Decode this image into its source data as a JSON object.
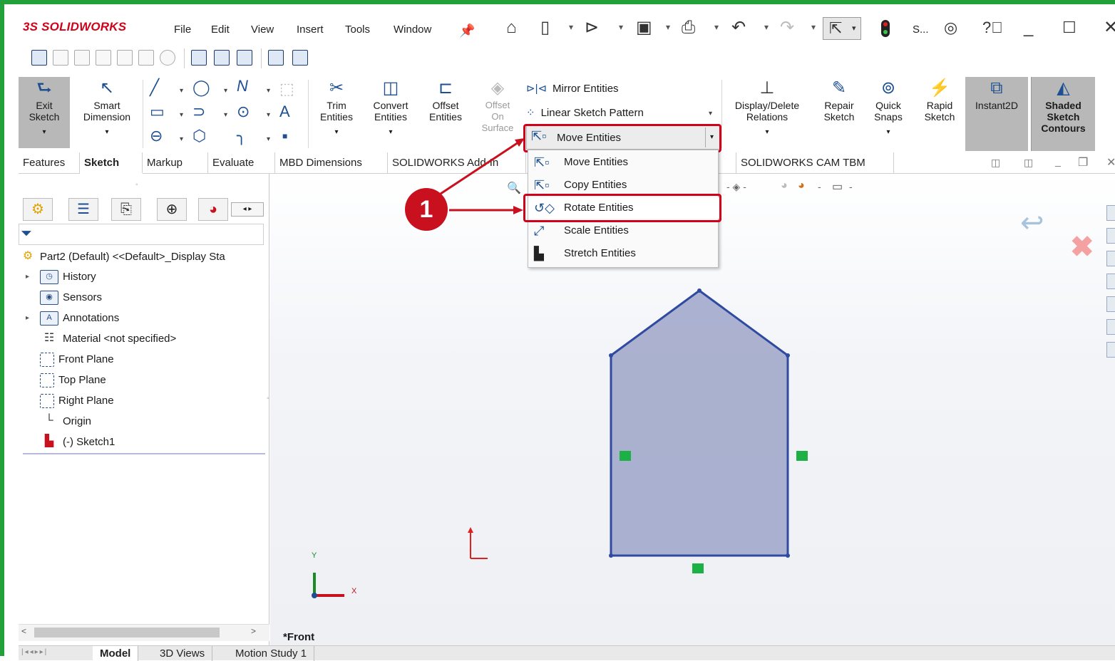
{
  "app": {
    "brand_prefix": "3S",
    "brand_name": "SOLIDWORKS",
    "user_short": "S...",
    "accent": "#22a03a",
    "highlight": "#d0021b"
  },
  "menu": [
    "File",
    "Edit",
    "View",
    "Insert",
    "Tools",
    "Window"
  ],
  "command_manager": {
    "exit_sketch": "Exit Sketch",
    "smart_dimension": "Smart Dimension",
    "trim_entities": "Trim Entities",
    "convert_entities": "Convert Entities",
    "offset_entities": "Offset Entities",
    "offset_on_surface": "Offset On Surface",
    "mirror_entities": "Mirror Entities",
    "linear_sketch_pattern": "Linear Sketch Pattern",
    "move_entities": "Move Entities",
    "display_delete_relations": "Display/Delete Relations",
    "repair_sketch": "Repair Sketch",
    "quick_snaps": "Quick Snaps",
    "rapid_sketch": "Rapid Sketch",
    "instant2d": "Instant2D",
    "shaded_sketch_contours": "Shaded Sketch Contours"
  },
  "tabs": [
    "Features",
    "Sketch",
    "Markup",
    "Evaluate",
    "MBD Dimensions",
    "SOLIDWORKS Add-In",
    "SOLIDWORKS CAM TBM"
  ],
  "active_tab": "Sketch",
  "dropdown": {
    "selected": "Move Entities",
    "items": [
      "Move Entities",
      "Copy Entities",
      "Rotate Entities",
      "Scale Entities",
      "Stretch Entities"
    ],
    "highlighted": "Rotate Entities"
  },
  "callout_number": "1",
  "tree": {
    "root": "Part2 (Default) <<Default>_Display Sta",
    "items": [
      {
        "label": "History",
        "icon": "history-icon"
      },
      {
        "label": "Sensors",
        "icon": "sensors-icon"
      },
      {
        "label": "Annotations",
        "icon": "annotations-icon"
      },
      {
        "label": "Material <not specified>",
        "icon": "material-icon"
      },
      {
        "label": "Front Plane",
        "icon": "plane-icon"
      },
      {
        "label": "Top Plane",
        "icon": "plane-icon"
      },
      {
        "label": "Right Plane",
        "icon": "plane-icon"
      },
      {
        "label": "Origin",
        "icon": "origin-icon"
      },
      {
        "label": "(-) Sketch1",
        "icon": "sketch-icon"
      }
    ]
  },
  "viewport": {
    "view_label": "*Front",
    "axis_y": "Y",
    "axis_x": "X"
  },
  "bottom_tabs": [
    "Model",
    "3D Views",
    "Motion Study 1"
  ],
  "active_bottom_tab": "Model"
}
